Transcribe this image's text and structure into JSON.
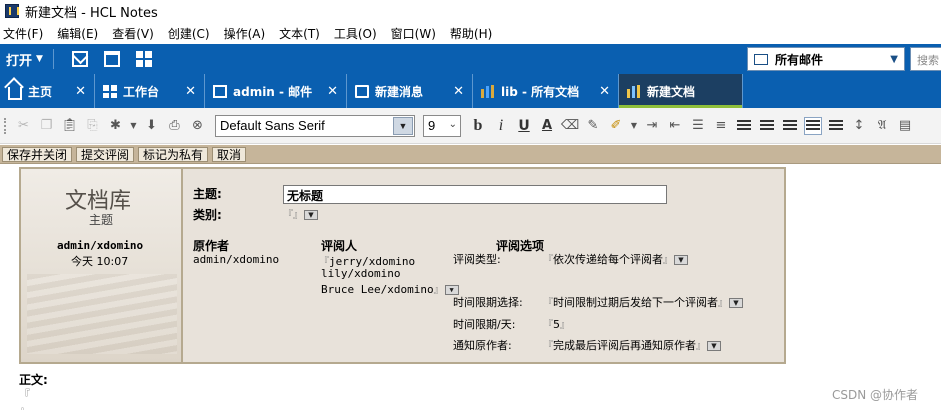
{
  "window": {
    "title": "新建文档 - HCL Notes"
  },
  "menu": [
    "文件(F)",
    "编辑(E)",
    "查看(V)",
    "创建(C)",
    "操作(A)",
    "文本(T)",
    "工具(O)",
    "窗口(W)",
    "帮助(H)"
  ],
  "actionbar": {
    "open_label": "打开",
    "mailbox_label": "所有邮件",
    "search_placeholder": "搜索"
  },
  "tabs": [
    {
      "label": "主页",
      "icon": "home-icon"
    },
    {
      "label": "工作台",
      "icon": "workspace-icon"
    },
    {
      "label": "admin - 邮件",
      "icon": "mail-icon"
    },
    {
      "label": "新建消息",
      "icon": "open-envelope-icon"
    },
    {
      "label": "lib - 所有文档",
      "icon": "database-icon"
    },
    {
      "label": "新建文档",
      "icon": "database-icon",
      "active": true
    }
  ],
  "format": {
    "font": "Default Sans Serif",
    "size": "9"
  },
  "buttons": [
    "保存并关闭",
    "提交评阅",
    "标记为私有",
    "取消"
  ],
  "form": {
    "lib_title": "文档库",
    "lib_subtitle": "主题",
    "author_display": "admin/xdomino",
    "time_display": "今天  10:07",
    "subject_label": "主题:",
    "subject_value": "无标题",
    "category_label": "类别:",
    "author_label": "原作者",
    "author_value": "admin/xdomino",
    "reviewer_label": "评阅人",
    "reviewers": [
      "jerry/xdomino",
      "lily/xdomino",
      "Bruce Lee/xdomino"
    ],
    "options_label": "评阅选项",
    "review_type_label": "评阅类型:",
    "review_type_value": "依次传递给每个评阅者",
    "time_limit_choice_label": "时间限期选择:",
    "time_limit_choice_value": "时间限制过期后发给下一个评阅者",
    "time_limit_days_label": "时间限期/天:",
    "time_limit_days_value": "5",
    "notify_label": "通知原作者:",
    "notify_value": "完成最后评阅后再通知原作者"
  },
  "body_label": "正文:",
  "watermark": "CSDN @协作者",
  "colors": {
    "action_bar": "#0a5fb0",
    "active_tab": "#1c3f62",
    "active_tab_accent": "#8fbf3a",
    "button_bar": "#c6b59a",
    "form_bg": "#e8e2da"
  }
}
